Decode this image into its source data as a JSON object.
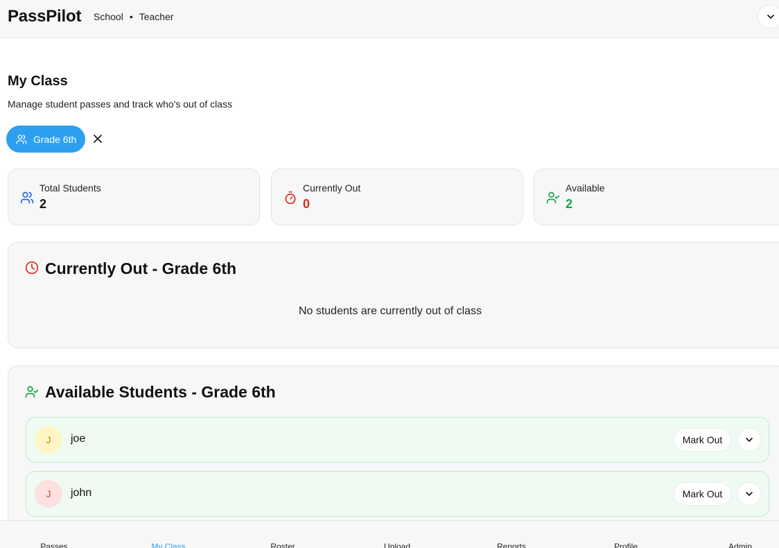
{
  "header": {
    "brand": "PassPilot",
    "school": "School",
    "separator": "•",
    "role": "Teacher"
  },
  "page": {
    "title": "My Class",
    "subtitle": "Manage student passes and track who's out of class"
  },
  "filter": {
    "grade_label": "Grade 6th"
  },
  "stats": [
    {
      "label": "Total Students",
      "value": "2",
      "color": "#111111",
      "icon": "users-icon"
    },
    {
      "label": "Currently Out",
      "value": "0",
      "color": "#d92d20",
      "icon": "timer-icon"
    },
    {
      "label": "Available",
      "value": "2",
      "color": "#16a34a",
      "icon": "user-check-icon"
    }
  ],
  "currently_out": {
    "title": "Currently Out - Grade 6th",
    "empty_message": "No students are currently out of class"
  },
  "available": {
    "title": "Available Students - Grade 6th",
    "students": [
      {
        "initial": "J",
        "name": "joe",
        "action": "Mark Out",
        "avatar_bg": "#fdf6c3",
        "avatar_fg": "#b08a14"
      },
      {
        "initial": "J",
        "name": "john",
        "action": "Mark Out",
        "avatar_bg": "#fde0e0",
        "avatar_fg": "#d14a4a"
      }
    ]
  },
  "bottom_nav": [
    {
      "label": "Passes",
      "active": false
    },
    {
      "label": "My Class",
      "active": true
    },
    {
      "label": "Roster",
      "active": false
    },
    {
      "label": "Upload",
      "active": false
    },
    {
      "label": "Reports",
      "active": false
    },
    {
      "label": "Profile",
      "active": false
    },
    {
      "label": "Admin",
      "active": false
    }
  ],
  "colors": {
    "accent": "#2d9ff0",
    "out_red": "#d92d20",
    "available_green": "#16a34a",
    "users_blue": "#2563eb"
  }
}
